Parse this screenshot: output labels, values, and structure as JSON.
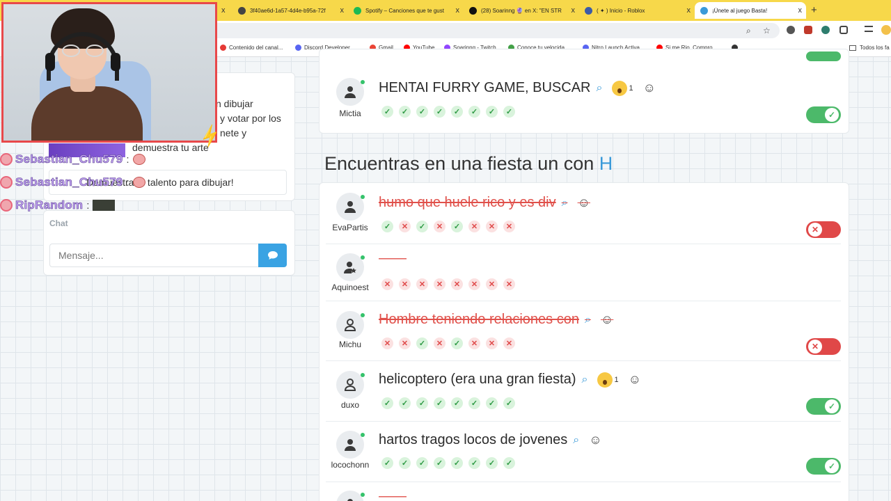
{
  "browser": {
    "tabs": [
      {
        "label": "3f40ae6d-1a57-4d4e-b95a-72f",
        "color": "#444444"
      },
      {
        "label": "Spotify – Canciones que te gust",
        "color": "#1db954"
      },
      {
        "label": "(28) Soarinng 🔮 en X: \"EN STR",
        "color": "#111111"
      },
      {
        "label": "( ✦ ) Inicio - Roblox",
        "color": "#3b5ba8"
      },
      {
        "label": "¡Únete al juego Basta!",
        "color": "#3a9ad9"
      }
    ],
    "close_glyph": "x",
    "new_tab": "+",
    "bookmarks": [
      {
        "label": "Contenido del canal...",
        "color": "#e53935"
      },
      {
        "label": "Discord Developer...",
        "color": "#5865f2"
      },
      {
        "label": "Gmail",
        "color": "#ea4335"
      },
      {
        "label": "YouTube",
        "color": "#ff0000"
      },
      {
        "label": "Soarinng - Twitch",
        "color": "#9146ff"
      },
      {
        "label": "Conoce tu velocida...",
        "color": "#43a047"
      },
      {
        "label": "Nitro Launch Activa...",
        "color": "#5865f2"
      },
      {
        "label": "Si me Rio, Compro...",
        "color": "#ff0000"
      }
    ],
    "other_bookmarks": "Todos los fa"
  },
  "left_panel": {
    "intro_lines": [
      "n dibujar",
      "y votar por los",
      "nete y",
      "demuestra tu arte"
    ],
    "tagline": "Demuestra tu talento para dibujar!",
    "chat_title": "Chat",
    "message_placeholder": "Mensaje..."
  },
  "stream_chat": [
    {
      "user": "Sebastian_Chu579",
      "colon": ":"
    },
    {
      "user": "Sebastian_Chu579",
      "colon": ":"
    },
    {
      "user": "RipRandom",
      "colon": ":"
    }
  ],
  "game": {
    "top_answer": {
      "player": "Mictia",
      "text": "HENTAI FURRY GAME, BUSCAR",
      "reaction_count": "1",
      "votes": [
        "ok",
        "ok",
        "ok",
        "ok",
        "ok",
        "ok",
        "ok",
        "ok"
      ],
      "valid": true
    },
    "category": {
      "prefix": "Encuentras en una fiesta un con",
      "letter": "H"
    },
    "answers": [
      {
        "player": "EvaPartis",
        "text": "humo que huele rico y es div",
        "struck": true,
        "reaction_count": "",
        "votes": [
          "ok",
          "no",
          "ok",
          "no",
          "ok",
          "no",
          "no",
          "no"
        ],
        "valid": false
      },
      {
        "player": "Aquinoest",
        "text": "——",
        "struck": true,
        "reaction_count": "",
        "votes": [
          "no",
          "no",
          "no",
          "no",
          "no",
          "no",
          "no",
          "no"
        ],
        "valid": null
      },
      {
        "player": "Michu",
        "text": "Hombre teniendo relaciones con",
        "struck": true,
        "reaction_count": "",
        "votes": [
          "no",
          "no",
          "ok",
          "no",
          "ok",
          "no",
          "no",
          "no"
        ],
        "valid": false
      },
      {
        "player": "duxo",
        "text": "helicoptero (era una gran fiesta)",
        "struck": false,
        "reaction_count": "1",
        "votes": [
          "ok",
          "ok",
          "ok",
          "ok",
          "ok",
          "ok",
          "ok",
          "ok"
        ],
        "valid": true
      },
      {
        "player": "locochonn",
        "text": "hartos tragos locos de jovenes",
        "struck": false,
        "reaction_count": "",
        "votes": [
          "ok",
          "ok",
          "ok",
          "ok",
          "ok",
          "ok",
          "ok",
          "ok"
        ],
        "valid": true
      }
    ],
    "check_glyph": "✓",
    "cross_glyph": "✕"
  }
}
